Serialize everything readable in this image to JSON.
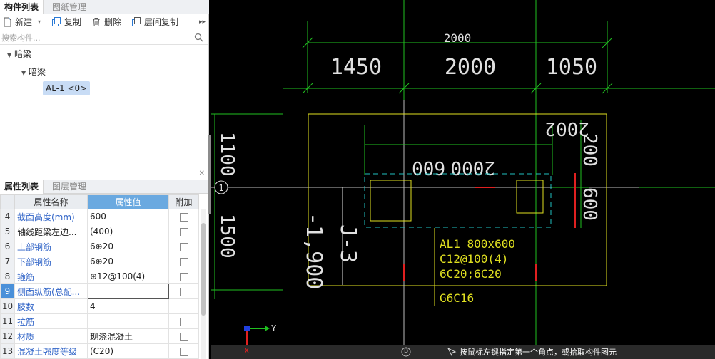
{
  "component_panel": {
    "tabs": [
      {
        "label": "构件列表"
      },
      {
        "label": "图纸管理"
      }
    ],
    "toolbar": {
      "new": "新建",
      "copy": "复制",
      "delete": "删除",
      "floor_copy": "层间复制"
    },
    "search": {
      "placeholder": "搜索构件..."
    },
    "tree": {
      "root": "暗梁",
      "child": "暗梁",
      "leaf": "AL-1 <0>"
    }
  },
  "property_panel": {
    "tabs": [
      {
        "label": "属性列表"
      },
      {
        "label": "图层管理"
      }
    ],
    "columns": {
      "name": "属性名称",
      "value": "属性值",
      "extra": "附加"
    },
    "rows": [
      {
        "num": "4",
        "name": "截面高度(mm)",
        "value": "600",
        "checkbox": true,
        "plain": false
      },
      {
        "num": "5",
        "name": "轴线距梁左边...",
        "value": "(400)",
        "checkbox": true,
        "plain": true
      },
      {
        "num": "6",
        "name": "上部钢筋",
        "value": "6⊕20",
        "checkbox": true,
        "plain": false
      },
      {
        "num": "7",
        "name": "下部钢筋",
        "value": "6⊕20",
        "checkbox": true,
        "plain": false
      },
      {
        "num": "8",
        "name": "箍筋",
        "value": "⊕12@100(4)",
        "checkbox": true,
        "plain": false
      },
      {
        "num": "9",
        "name": "侧面纵筋(总配...",
        "value": "",
        "checkbox": true,
        "plain": false,
        "selected": true
      },
      {
        "num": "10",
        "name": "肢数",
        "value": "4",
        "checkbox": false,
        "plain": false
      },
      {
        "num": "11",
        "name": "拉筋",
        "value": "",
        "checkbox": true,
        "plain": false
      },
      {
        "num": "12",
        "name": "材质",
        "value": "现浇混凝土",
        "checkbox": true,
        "plain": false
      },
      {
        "num": "13",
        "name": "混凝土强度等级",
        "value": "(C20)",
        "checkbox": true,
        "plain": false
      }
    ]
  },
  "canvas": {
    "dims_top": {
      "overall": "2000",
      "a": "1450",
      "b": "2000",
      "c": "1050"
    },
    "dims_left": {
      "a": "1100",
      "b": "1500"
    },
    "inner": {
      "w_top": "2000",
      "w_left": "600",
      "h_right_a": "2002",
      "h_right_b": "200",
      "h_right_c": "600"
    },
    "elevation": "-1,900",
    "tag": "J-3",
    "annotation": [
      "AL1 800x600",
      "C12@100(4)",
      "6C20;6C20",
      "G6C16"
    ],
    "axis_label": "1",
    "axis_b": "B",
    "ucs_y": "Y",
    "ucs_x": "X",
    "status": "按鼠标左键指定第一个角点，或拾取构件图元",
    "colors": {
      "green": "#20c020",
      "yellow": "#e0e020",
      "cyan": "#20c0c0",
      "red": "#e02020",
      "white": "#e0e0e0"
    }
  }
}
